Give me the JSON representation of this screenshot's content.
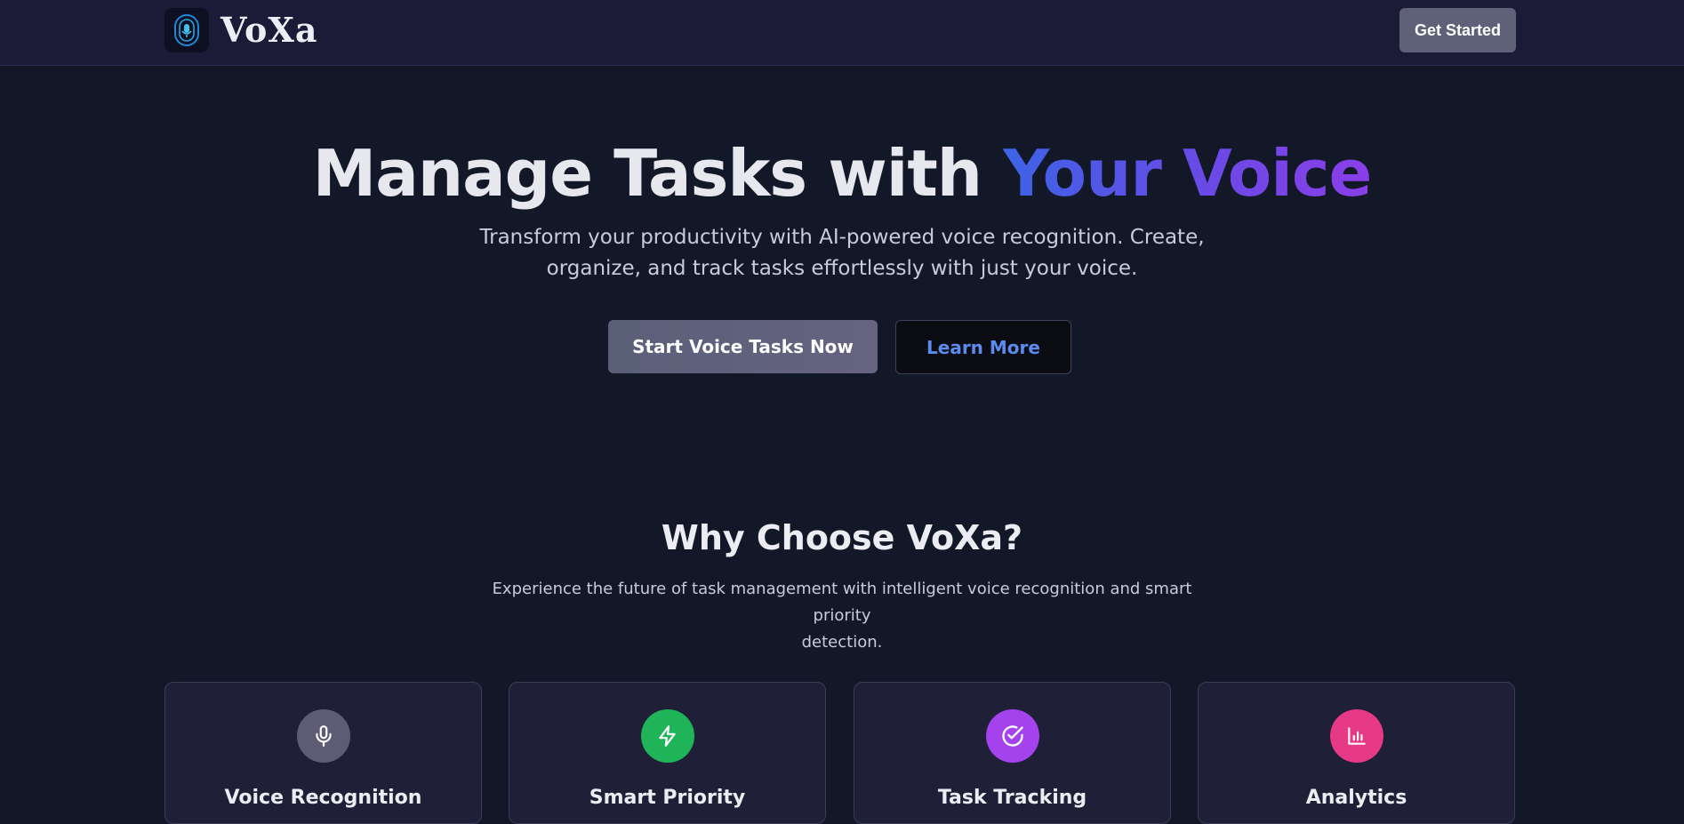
{
  "nav": {
    "brand": "VoXa",
    "cta_label": "Get Started"
  },
  "hero": {
    "title_main": "Manage Tasks with ",
    "title_accent": "Your Voice",
    "subtitle_line1": "Transform your productivity with AI-powered voice recognition. Create,",
    "subtitle_line2": "organize, and track tasks effortlessly with just your voice.",
    "primary_button": "Start Voice Tasks Now",
    "secondary_button": "Learn More"
  },
  "features": {
    "title": "Why Choose VoXa?",
    "subtitle_line1": "Experience the future of task management with intelligent voice recognition and smart priority",
    "subtitle_line2": "detection.",
    "cards": [
      {
        "title": "Voice Recognition",
        "icon": "microphone-icon",
        "color": "#5e5b75"
      },
      {
        "title": "Smart Priority",
        "icon": "lightning-icon",
        "color": "#1fb457"
      },
      {
        "title": "Task Tracking",
        "icon": "check-circle-icon",
        "color": "#a443ee"
      },
      {
        "title": "Analytics",
        "icon": "bar-chart-icon",
        "color": "#e73a86"
      }
    ]
  },
  "colors": {
    "background": "#121828",
    "navbar": "#1b1b37",
    "accent_gradient_start": "#3d63e6",
    "accent_gradient_end": "#8a3ee8",
    "link_blue": "#5a8cf0"
  }
}
